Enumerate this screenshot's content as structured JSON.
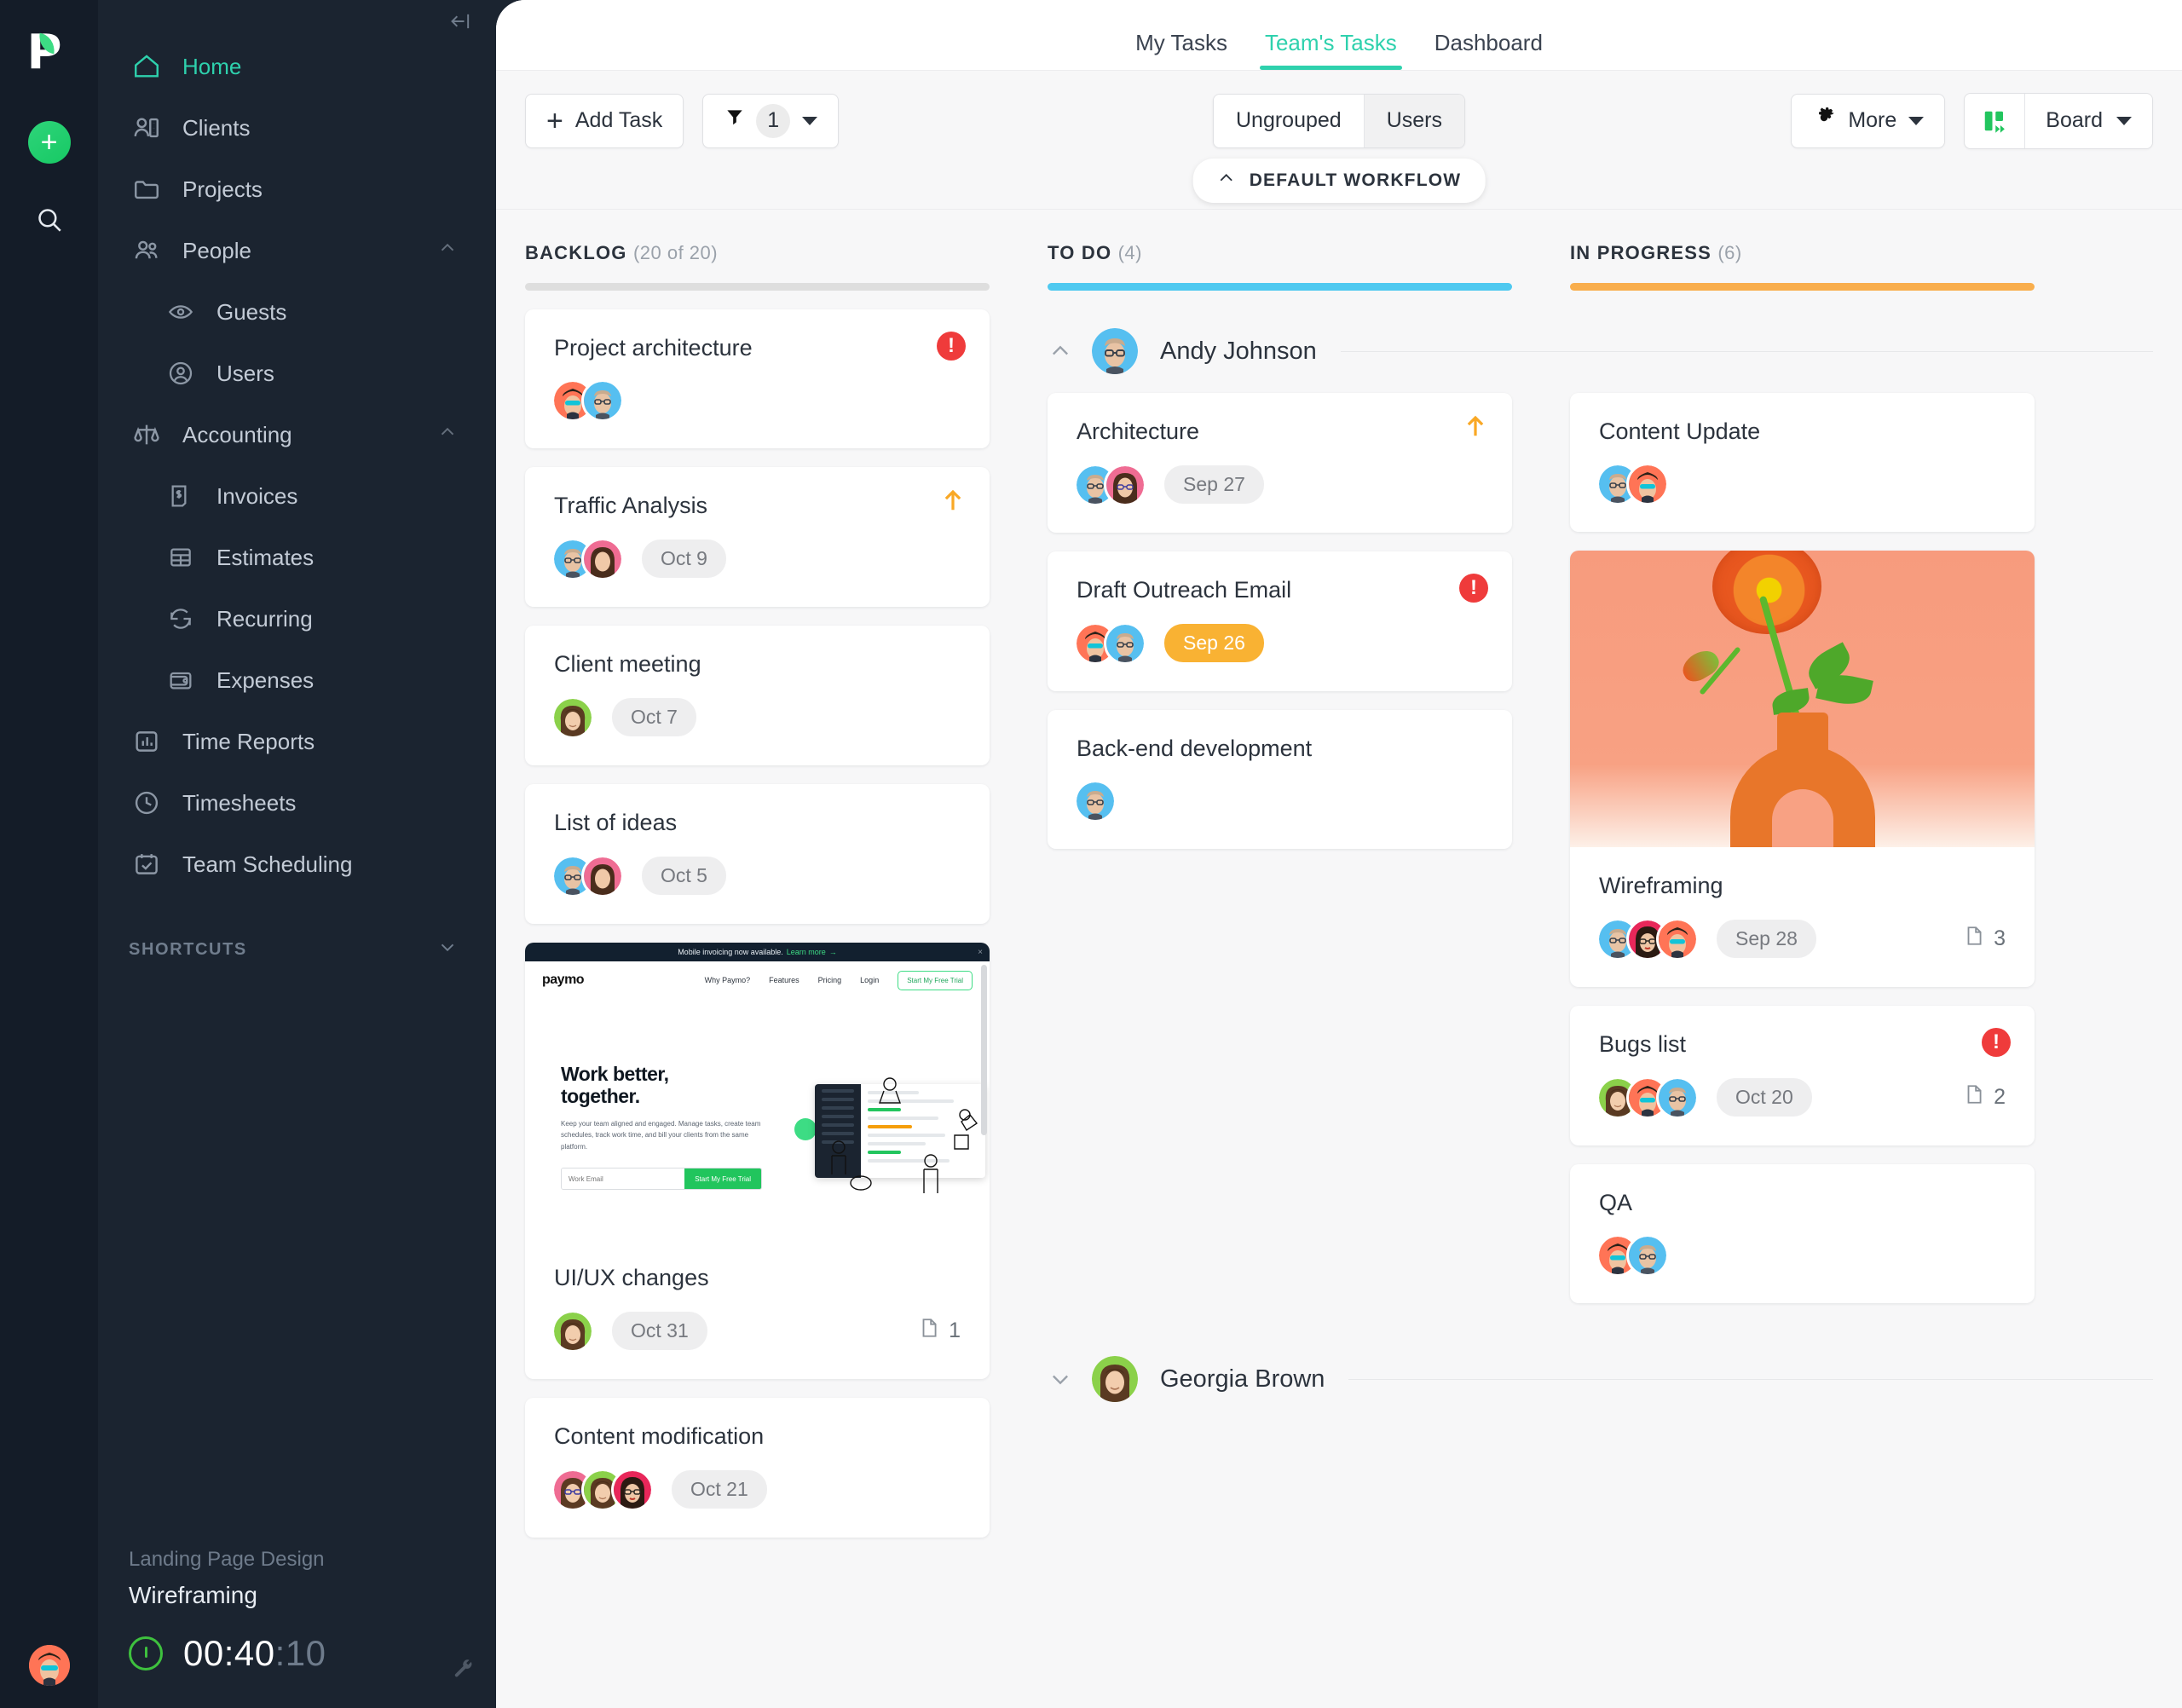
{
  "brand": {
    "name": "Paymo",
    "accent": "#2ed1ad",
    "green": "#17c964"
  },
  "rail": {
    "logo_letter": "P",
    "add_label": "+",
    "search_icon": "search-icon",
    "avatar_icon": "user-avatar"
  },
  "sidebar": {
    "collapse_icon": "collapse-sidebar-icon",
    "items": [
      {
        "label": "Home",
        "icon": "home-icon",
        "active": true
      },
      {
        "label": "Clients",
        "icon": "clients-icon"
      },
      {
        "label": "Projects",
        "icon": "folder-icon"
      },
      {
        "label": "People",
        "icon": "people-icon",
        "expandable": true,
        "expanded": true
      },
      {
        "label": "Guests",
        "icon": "eye-icon",
        "sub": true
      },
      {
        "label": "Users",
        "icon": "user-circle-icon",
        "sub": true
      },
      {
        "label": "Accounting",
        "icon": "scales-icon",
        "expandable": true,
        "expanded": true
      },
      {
        "label": "Invoices",
        "icon": "invoice-icon",
        "sub": true
      },
      {
        "label": "Estimates",
        "icon": "table-icon",
        "sub": true
      },
      {
        "label": "Recurring",
        "icon": "recurring-icon",
        "sub": true
      },
      {
        "label": "Expenses",
        "icon": "wallet-icon",
        "sub": true
      },
      {
        "label": "Time Reports",
        "icon": "bar-chart-icon"
      },
      {
        "label": "Timesheets",
        "icon": "clock-icon"
      },
      {
        "label": "Team Scheduling",
        "icon": "calendar-check-icon"
      }
    ],
    "shortcuts_label": "SHORTCUTS",
    "timer": {
      "project": "Landing Page Design",
      "task": "Wireframing",
      "elapsed_hm": "00:40",
      "elapsed_seconds": "10",
      "play_icon": "timer-start-icon",
      "settings_icon": "wrench-icon"
    }
  },
  "tabs": [
    {
      "label": "My Tasks",
      "active": false
    },
    {
      "label": "Team's Tasks",
      "active": true
    },
    {
      "label": "Dashboard",
      "active": false
    }
  ],
  "toolbar": {
    "add_task_label": "Add Task",
    "filter_icon": "funnel-icon",
    "filter_count": "1",
    "group_segments": [
      {
        "label": "Ungrouped",
        "selected": false
      },
      {
        "label": "Users",
        "selected": true
      }
    ],
    "more_label": "More",
    "more_icon": "gear-icon",
    "view_icon": "board-view-icon",
    "view_label": "Board"
  },
  "workflow": {
    "label": "DEFAULT WORKFLOW",
    "chevron": "chevron-up-icon"
  },
  "columns": [
    {
      "name": "BACKLOG",
      "count": "(20 of 20)",
      "bar_color": "#dedede"
    },
    {
      "name": "TO DO",
      "count": "(4)",
      "bar_color": "#4fc9f0"
    },
    {
      "name": "IN PROGRESS",
      "count": "(6)",
      "bar_color": "#f9ae4d"
    }
  ],
  "backlog_cards": [
    {
      "title": "Project architecture",
      "date": "",
      "alert": true,
      "avatars": [
        "coral-hat-sunglasses",
        "blue-glasses-man"
      ],
      "attachments": ""
    },
    {
      "title": "Traffic Analysis",
      "date": "Oct 9",
      "priority_up": true,
      "avatars": [
        "blue-glasses-man",
        "pink-longhair-woman"
      ],
      "attachments": ""
    },
    {
      "title": "Client meeting",
      "date": "Oct 7",
      "avatars": [
        "green-smiling-woman"
      ],
      "attachments": ""
    },
    {
      "title": "List of ideas",
      "date": "Oct 5",
      "avatars": [
        "blue-glasses-man",
        "pink-longhair-woman"
      ],
      "attachments": ""
    },
    {
      "title": "UI/UX changes",
      "date": "Oct 31",
      "avatars": [
        "green-smiling-woman"
      ],
      "attachments": "1",
      "cover": "landing-page-preview"
    },
    {
      "title": "Content modification",
      "date": "Oct 21",
      "avatars": [
        "pink-glasses-woman",
        "green-smiling-woman",
        "crimson-glasses-woman"
      ],
      "attachments": ""
    }
  ],
  "todo_groups": [
    {
      "user": "Andy Johnson",
      "avatar": "blue-glasses-man",
      "expanded": true,
      "chevron": "chevron-up-icon",
      "cards": [
        {
          "title": "Architecture",
          "date": "Sep 27",
          "priority_up": true,
          "avatars": [
            "blue-glasses-man",
            "pink-longhair-woman"
          ]
        },
        {
          "title": "Draft Outreach Email",
          "date": "Sep 26",
          "date_warn": true,
          "alert": true,
          "avatars": [
            "coral-hat-sunglasses",
            "blue-glasses-man"
          ]
        },
        {
          "title": "Back-end development",
          "date": "",
          "avatars": [
            "blue-glasses-man"
          ]
        }
      ]
    },
    {
      "user": "Georgia Brown",
      "avatar": "green-smiling-woman",
      "expanded": false,
      "chevron": "chevron-down-icon",
      "cards": []
    }
  ],
  "inprogress_cards": [
    {
      "title": "Content Update",
      "date": "",
      "avatars": [
        "blue-glasses-man",
        "coral-hat-sunglasses"
      ],
      "attachments": ""
    },
    {
      "title": "Wireframing",
      "date": "Sep 28",
      "avatars": [
        "blue-glasses-man",
        "pink-glasses-woman",
        "coral-hat-sunglasses"
      ],
      "attachments": "3",
      "cover": "orange-flower-vase"
    },
    {
      "title": "Bugs list",
      "date": "Oct 20",
      "alert": true,
      "avatars": [
        "green-smiling-woman",
        "coral-hat-sunglasses",
        "blue-glasses-man"
      ],
      "attachments": "2"
    },
    {
      "title": "QA",
      "date": "",
      "avatars": [
        "coral-hat-sunglasses",
        "blue-glasses-man"
      ],
      "attachments": ""
    }
  ],
  "landing_preview": {
    "banner": "Mobile invoicing now available.",
    "banner_link": "Learn more",
    "logo": "paymo",
    "nav": [
      "Why Paymo?",
      "Features",
      "Pricing",
      "Login"
    ],
    "nav_cta": "Start My Free Trial",
    "headline_1": "Work better,",
    "headline_2": "together.",
    "paragraph": "Keep your team aligned and engaged. Manage tasks, create team schedules, track work time, and bill your clients from the same platform.",
    "email_placeholder": "Work Email",
    "form_cta": "Start My Free Trial"
  }
}
